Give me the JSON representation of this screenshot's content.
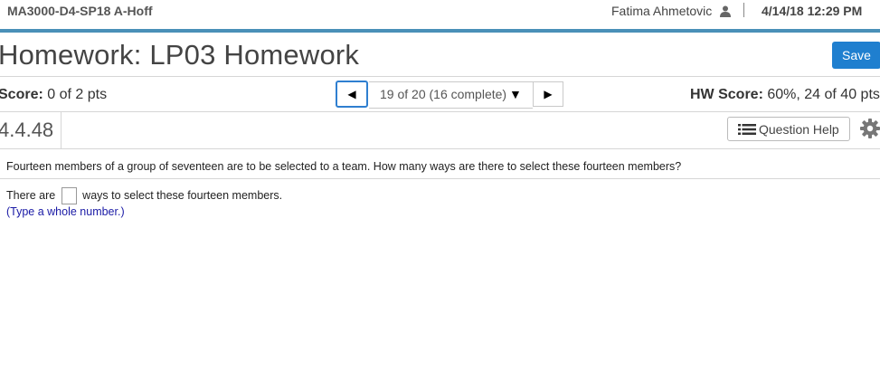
{
  "header": {
    "course": "MA3000-D4-SP18 A-Hoff",
    "user_name": "Fatima Ahmetovic",
    "datetime": "4/14/18 12:29 PM",
    "user_icon": "user-icon"
  },
  "homework": {
    "title": "Homework: LP03 Homework",
    "save_label": "Save"
  },
  "score_bar": {
    "score_label": "Score:",
    "score_value": "0 of 2 pts",
    "question_selector": "19 of 20 (16 complete)",
    "hw_score_label": "HW Score:",
    "hw_score_value": "60%, 24 of 40 pts"
  },
  "question_bar": {
    "number": "4.4.48",
    "help_label": "Question Help"
  },
  "question": {
    "text": "Fourteen members of a group of seventeen are to be selected to a team. How many ways are there to select these fourteen members?",
    "answer_prefix": "There are",
    "answer_suffix": "ways to select these fourteen members.",
    "hint": "(Type a whole number.)"
  },
  "colors": {
    "accent": "#1f7fcf",
    "top_border": "#4a90b8",
    "hint": "#1a1aa6"
  }
}
